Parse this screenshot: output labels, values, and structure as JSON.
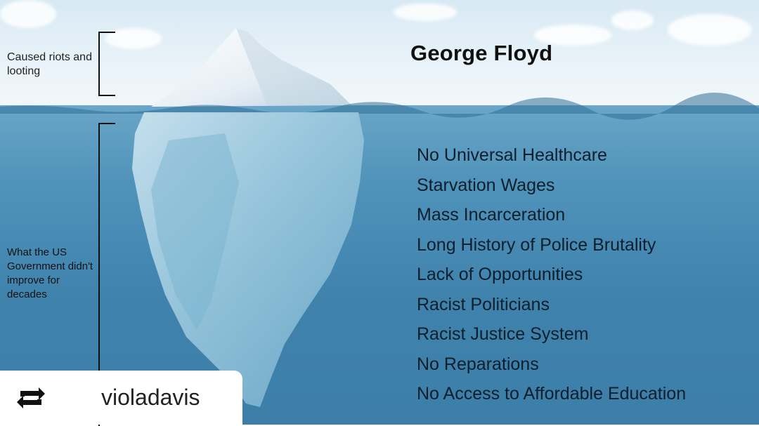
{
  "meme": {
    "headline": "George Floyd",
    "above_water_label": "Caused riots and looting",
    "below_water_label": "What the US Government didn't improve for decades",
    "causes": [
      "No Universal Healthcare",
      "Starvation Wages",
      "Mass Incarceration",
      "Long History of Police Brutality",
      "Lack of Opportunities",
      "Racist Politicians",
      "Racist Justice System",
      "No Reparations",
      "No Access to Affordable Education"
    ]
  },
  "repost": {
    "icon": "repost-icon",
    "username": "violadavis"
  },
  "colors": {
    "text": "#111111",
    "water": "#4f92ba",
    "sky": "#e4f0f7"
  }
}
